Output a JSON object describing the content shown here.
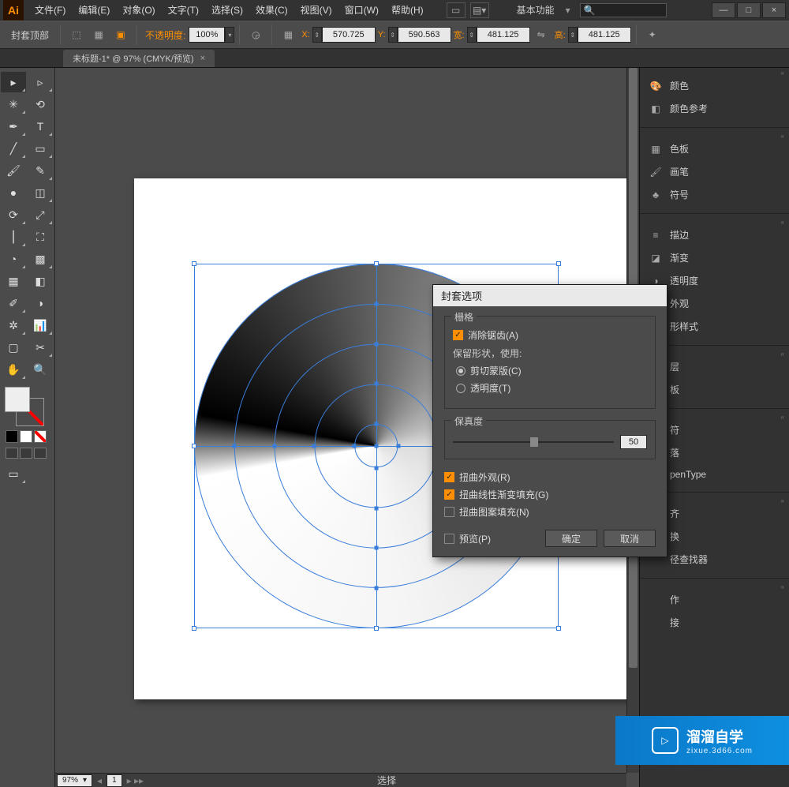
{
  "app": {
    "logo": "Ai"
  },
  "menu": [
    "文件(F)",
    "编辑(E)",
    "对象(O)",
    "文字(T)",
    "选择(S)",
    "效果(C)",
    "视图(V)",
    "窗口(W)",
    "帮助(H)"
  ],
  "workspace": "基本功能",
  "search_placeholder": "",
  "window_controls": {
    "min": "—",
    "max": "□",
    "close": "×"
  },
  "controlbar": {
    "label": "封套顶部",
    "opacity_label": "不透明度:",
    "opacity_value": "100%",
    "x_label": "X:",
    "x_value": "570.725",
    "y_label": "Y:",
    "y_value": "590.563",
    "w_label": "宽:",
    "w_value": "481.125",
    "h_label": "高:",
    "h_value": "481.125"
  },
  "tab": {
    "title": "未标题-1* @ 97% (CMYK/预览)"
  },
  "status": {
    "zoom": "97%",
    "page": "1",
    "mode": "选择"
  },
  "panels": [
    {
      "icon": "🎨",
      "label": "颜色",
      "k": "color"
    },
    {
      "icon": "◧",
      "label": "颜色参考",
      "k": "color-guide"
    },
    {
      "sep": true
    },
    {
      "icon": "▦",
      "label": "色板",
      "k": "swatches"
    },
    {
      "icon": "🖌",
      "label": "画笔",
      "k": "brushes"
    },
    {
      "icon": "♣",
      "label": "符号",
      "k": "symbols"
    },
    {
      "sep": true
    },
    {
      "icon": "≡",
      "label": "描边",
      "k": "stroke"
    },
    {
      "icon": "◪",
      "label": "渐变",
      "k": "gradient"
    },
    {
      "icon": "◑",
      "label": "透明度",
      "k": "transparency"
    },
    {
      "icon": "◉",
      "label": "外观",
      "k": "appearance"
    },
    {
      "cut": true,
      "label": "形样式",
      "k": "gstyle"
    },
    {
      "sep": true
    },
    {
      "cut": true,
      "label": "层",
      "k": "layers"
    },
    {
      "cut": true,
      "label": "板",
      "k": "artboards"
    },
    {
      "sep": true
    },
    {
      "cut": true,
      "label": "符",
      "k": "char"
    },
    {
      "cut": true,
      "label": "落",
      "k": "para"
    },
    {
      "cut": true,
      "label": "penType",
      "k": "opentype"
    },
    {
      "sep": true
    },
    {
      "cut": true,
      "label": "齐",
      "k": "align"
    },
    {
      "cut": true,
      "label": "换",
      "k": "transform"
    },
    {
      "cut": true,
      "label": "径查找器",
      "k": "pathfinder"
    },
    {
      "sep": true
    },
    {
      "cut": true,
      "label": "作",
      "k": "actions"
    },
    {
      "cut": true,
      "label": "接",
      "k": "links"
    }
  ],
  "dialog": {
    "title": "封套选项",
    "raster_legend": "栅格",
    "antialias": "消除锯齿(A)",
    "preserve_label": "保留形状，使用:",
    "clip": "剪切蒙版(C)",
    "trans": "透明度(T)",
    "fidelity_legend": "保真度",
    "fidelity_value": "50",
    "distort_appearance": "扭曲外观(R)",
    "distort_gradient": "扭曲线性渐变填充(G)",
    "distort_pattern": "扭曲图案填充(N)",
    "preview": "预览(P)",
    "ok": "确定",
    "cancel": "取消"
  },
  "watermark": {
    "brand": "溜溜自学",
    "url": "zixue.3d66.com"
  }
}
